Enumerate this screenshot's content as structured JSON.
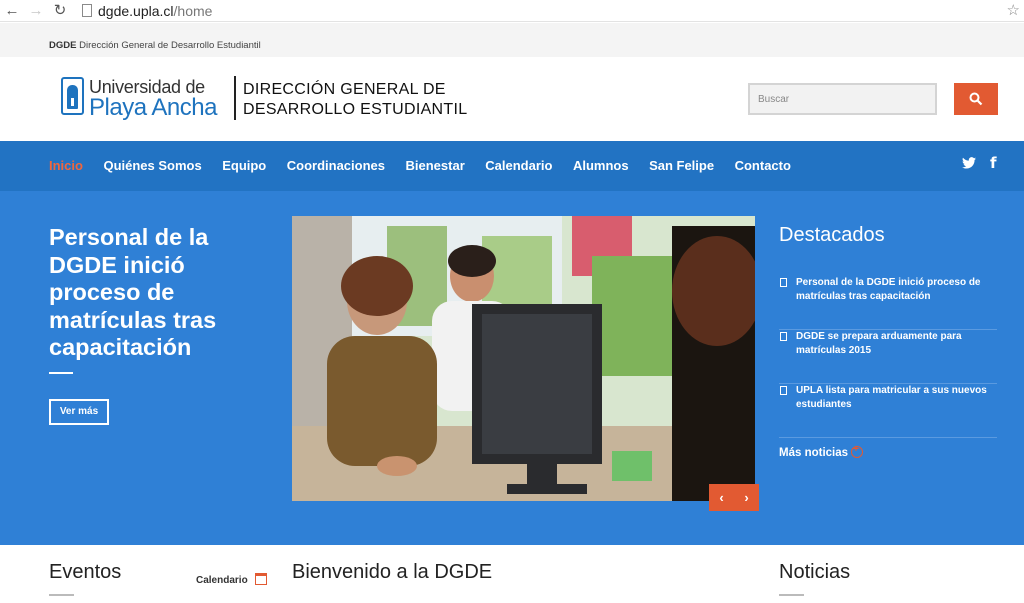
{
  "browser": {
    "url_host": "dgde.upla.cl",
    "url_path": "/home"
  },
  "topbar": {
    "brand_short": "DGDE",
    "brand_long": "Dirección General de Desarrollo Estudiantil"
  },
  "header": {
    "logo_line1": "Universidad de",
    "logo_line2": "Playa Ancha",
    "dept_line1": "DIRECCIÓN GENERAL DE",
    "dept_line2": "DESARROLLO ESTUDIANTIL",
    "search_placeholder": "Buscar"
  },
  "nav": {
    "items": [
      "Inicio",
      "Quiénes Somos",
      "Equipo",
      "Coordinaciones",
      "Bienestar",
      "Calendario",
      "Alumnos",
      "San Felipe",
      "Contacto"
    ],
    "active_index": 0,
    "social": [
      "twitter-icon",
      "facebook-icon"
    ]
  },
  "hero": {
    "title": "Personal de la DGDE inició proceso de matrículas tras capacitación",
    "button": "Ver más"
  },
  "destacados": {
    "title": "Destacados",
    "items": [
      "Personal de la DGDE inició proceso de matrículas tras capacitación",
      "DGDE se prepara arduamente para matrículas 2015",
      "UPLA lista para matricular a sus nuevos estudiantes"
    ],
    "more": "Más noticias"
  },
  "sections": {
    "eventos": "Eventos",
    "calendario": "Calendario",
    "bienvenido": "Bienvenido a la DGDE",
    "noticias": "Noticias"
  },
  "colors": {
    "nav_bg": "#2273c3",
    "hero_bg": "#2f80d6",
    "accent": "#e25a32"
  }
}
